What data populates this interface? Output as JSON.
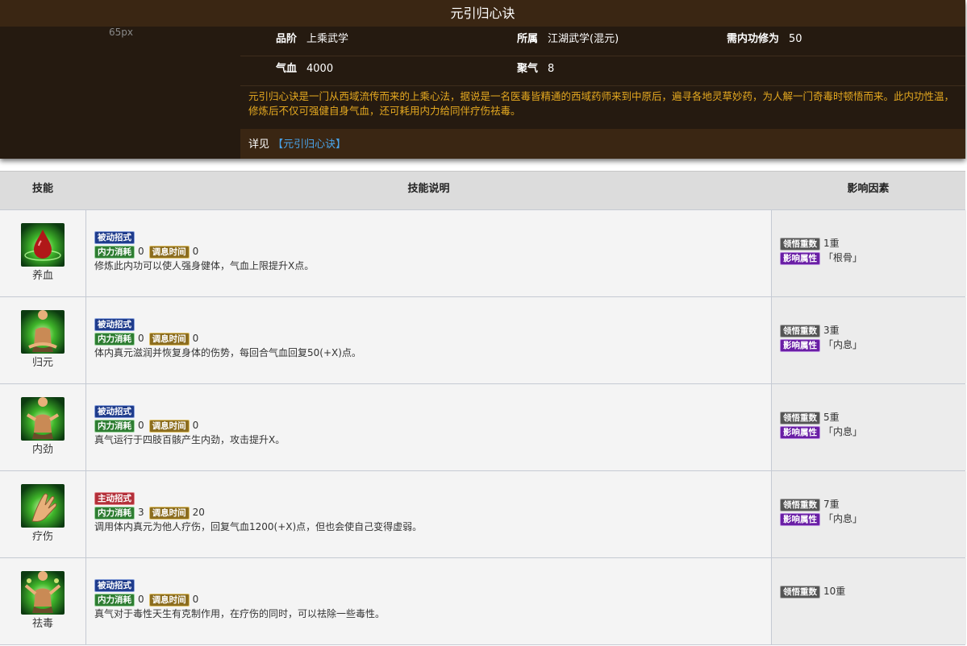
{
  "header": {
    "title": "元引归心诀",
    "image_placeholder": "65px",
    "info": {
      "grade_label": "品阶",
      "grade_value": "上乘武学",
      "faction_label": "所属",
      "faction_value": "江湖武学(混元)",
      "req_label": "需内功修为",
      "req_value": "50",
      "hp_label": "气血",
      "hp_value": "4000",
      "qi_label": "聚气",
      "qi_value": "8"
    },
    "description": "元引归心诀是一门从西域流传而来的上乘心法，据说是一名医毒皆精通的西域药师来到中原后，遍寻各地灵草妙药，为人解一门奇毒时顿悟而来。此内功性温，修炼后不仅可强健自身气血，还可耗用内力给同伴疗伤祛毒。",
    "see_also_label": "详见",
    "see_also_link": "【元引归心诀】"
  },
  "table": {
    "headers": {
      "skill": "技能",
      "desc": "技能说明",
      "factor": "影响因素"
    },
    "tag_labels": {
      "cost": "内力消耗",
      "time": "调息时间",
      "grade": "领悟重数",
      "attr": "影响属性"
    },
    "rows": [
      {
        "name": "养血",
        "icon": "blood-drop-icon",
        "type": "被动招式",
        "kind": "passive",
        "cost": "0",
        "time": "0",
        "text": "修炼此内功可以使人强身健体，气血上限提升X点。",
        "grade": "1重",
        "attr": "「根骨」"
      },
      {
        "name": "归元",
        "icon": "meditating-figure-icon",
        "type": "被动招式",
        "kind": "passive",
        "cost": "0",
        "time": "0",
        "text": "体内真元滋润并恢复身体的伤势，每回合气血回复50(+X)点。",
        "grade": "3重",
        "attr": "「内息」"
      },
      {
        "name": "内劲",
        "icon": "power-figure-icon",
        "type": "被动招式",
        "kind": "passive",
        "cost": "0",
        "time": "0",
        "text": "真气运行于四肢百骸产生内劲，攻击提升X。",
        "grade": "5重",
        "attr": "「内息」"
      },
      {
        "name": "疗伤",
        "icon": "healing-hand-icon",
        "type": "主动招式",
        "kind": "active",
        "cost": "3",
        "time": "20",
        "text": "调用体内真元为他人疗伤，回复气血1200(+X)点，但也会使自己变得虚弱。",
        "grade": "7重",
        "attr": "「内息」"
      },
      {
        "name": "祛毒",
        "icon": "detox-figure-icon",
        "type": "被动招式",
        "kind": "passive",
        "cost": "0",
        "time": "0",
        "text": "真气对于毒性天生有克制作用，在疗伤的同时，可以祛除一些毒性。",
        "grade": "10重",
        "attr": null
      }
    ]
  }
}
